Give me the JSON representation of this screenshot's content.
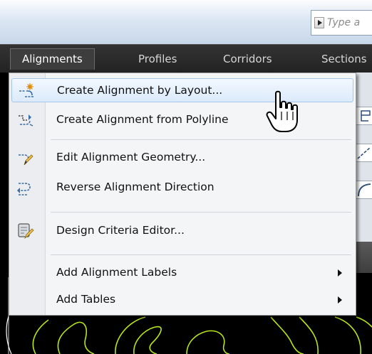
{
  "command_line": {
    "placeholder": "Type a"
  },
  "menubar": {
    "items": [
      {
        "label": "Alignments",
        "active": true
      },
      {
        "label": "Profiles"
      },
      {
        "label": "Corridors"
      },
      {
        "label": "Sections"
      }
    ]
  },
  "dropdown": {
    "items": [
      {
        "label": "Create Alignment by Layout...",
        "icon": "alignment-layout-icon",
        "highlighted": true
      },
      {
        "label": "Create Alignment from Polyline",
        "icon": "alignment-polyline-icon"
      },
      {
        "label": "Edit Alignment Geometry...",
        "icon": "edit-geometry-icon"
      },
      {
        "label": "Reverse Alignment Direction",
        "icon": "reverse-direction-icon"
      },
      {
        "label": "Design Criteria Editor...",
        "icon": "design-criteria-icon"
      },
      {
        "label": "Add Alignment Labels",
        "submenu": true
      },
      {
        "label": "Add Tables",
        "submenu": true
      }
    ]
  },
  "colors": {
    "contour": "#b7e619",
    "menu_bg": "#f4f5f7",
    "highlight_border": "#a7c5e5"
  },
  "cursor": "hand-pointer-icon"
}
